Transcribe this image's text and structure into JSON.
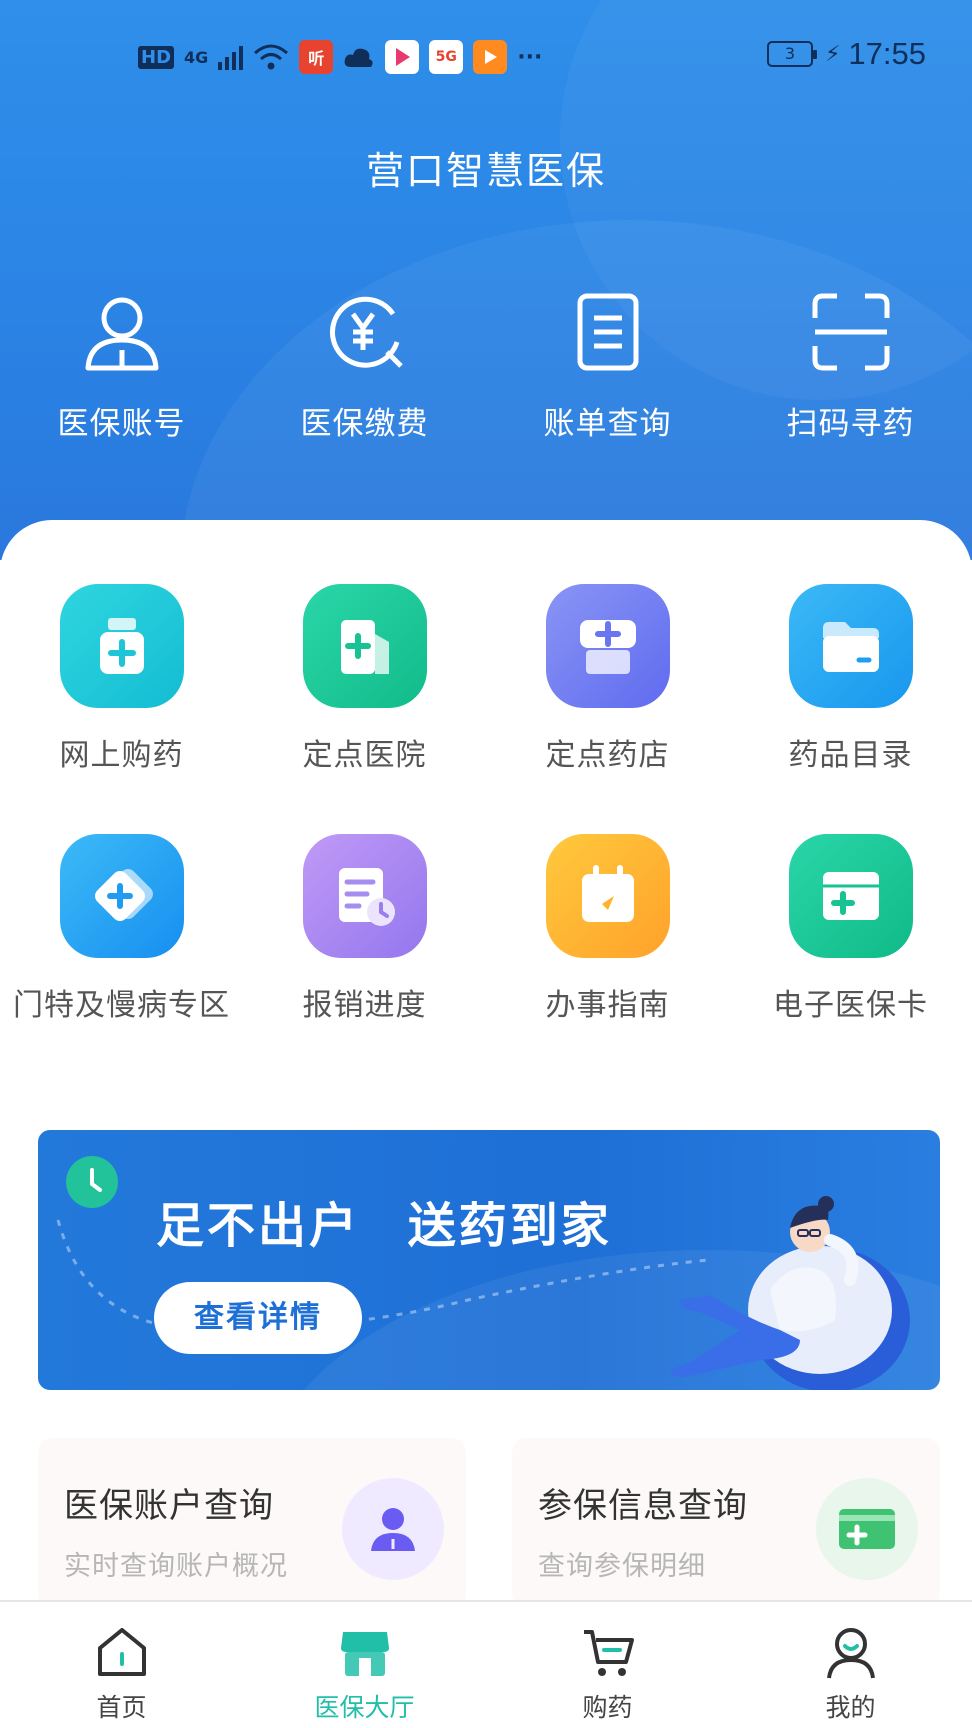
{
  "status_bar": {
    "time": "17:55",
    "network_badge": "HD",
    "network_type": "4G",
    "battery_level": "3",
    "app_badges": [
      "听",
      "5G"
    ]
  },
  "header": {
    "title": "营口智慧医保"
  },
  "top_actions": [
    {
      "label": "医保账号",
      "icon": "user-icon"
    },
    {
      "label": "医保缴费",
      "icon": "yuan-payment-icon"
    },
    {
      "label": "账单查询",
      "icon": "bill-document-icon"
    },
    {
      "label": "扫码寻药",
      "icon": "scan-icon"
    }
  ],
  "services": [
    {
      "label": "网上购药",
      "icon": "medicine-bottle-icon",
      "color": "#1fc9d8"
    },
    {
      "label": "定点医院",
      "icon": "hospital-icon",
      "color": "#1fc79a"
    },
    {
      "label": "定点药店",
      "icon": "pharmacy-store-icon",
      "color": "#6f7ff2"
    },
    {
      "label": "药品目录",
      "icon": "folder-icon",
      "color": "#24a8f2"
    },
    {
      "label": "门特及慢病专区",
      "icon": "chronic-disease-icon",
      "color": "#27a9f3"
    },
    {
      "label": "报销进度",
      "icon": "reimbursement-progress-icon",
      "color": "#a98ef0"
    },
    {
      "label": "办事指南",
      "icon": "calendar-guide-icon",
      "color": "#ffb533"
    },
    {
      "label": "电子医保卡",
      "icon": "medical-card-icon",
      "color": "#1fc79a"
    }
  ],
  "banner": {
    "headline": "足不出户 送药到家",
    "cta": "查看详情"
  },
  "cards": [
    {
      "title": "医保账户查询",
      "subtitle": "实时查询账户概况",
      "icon": "account-person-icon",
      "icon_bg": "#efeaff",
      "icon_color": "#6a5cf2"
    },
    {
      "title": "参保信息查询",
      "subtitle": "查询参保明细",
      "icon": "insurance-card-icon",
      "icon_bg": "#e8f6ec",
      "icon_color": "#3fc272"
    }
  ],
  "bottom_nav": [
    {
      "label": "首页",
      "icon": "home-icon",
      "active": false
    },
    {
      "label": "医保大厅",
      "icon": "hall-icon",
      "active": true
    },
    {
      "label": "购药",
      "icon": "cart-icon",
      "active": false
    },
    {
      "label": "我的",
      "icon": "profile-icon",
      "active": false
    }
  ]
}
